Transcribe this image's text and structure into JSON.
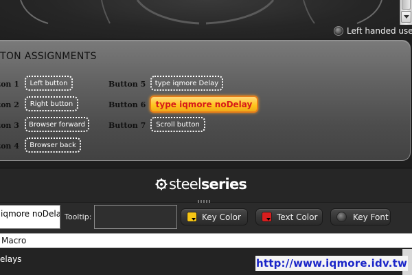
{
  "window": {
    "left_handed_label": "Left handed use"
  },
  "assignments": {
    "title": "TON ASSIGNMENTS",
    "buttons": [
      {
        "label": "ton 1",
        "value": "Left button"
      },
      {
        "label": "ton 2",
        "value": "Right button"
      },
      {
        "label": "ton 3",
        "value": "Browser forward"
      },
      {
        "label": "ton 4",
        "value": "Browser back"
      },
      {
        "label": "Button 5",
        "value": "type iqmore Delay"
      },
      {
        "label": "Button 6",
        "value": "type iqmore noDelay"
      },
      {
        "label": "Button 7",
        "value": "Scroll button"
      }
    ]
  },
  "logo": {
    "part1": "steel",
    "part2": "series"
  },
  "toolbar": {
    "name_value": "iqmore noDela",
    "tooltip_label": "Tooltip:",
    "tooltip_value": "",
    "key_color_label": "Key Color",
    "text_color_label": "Text Color",
    "key_font_label": "Key Font"
  },
  "colors": {
    "key_color": "#f6c514",
    "text_color": "#d81e1e",
    "highlight_border": "#e47d1b"
  },
  "rows": {
    "macro": "Macro",
    "delays": "elays"
  },
  "watermark": "http://www.iqmore.idv.tw"
}
